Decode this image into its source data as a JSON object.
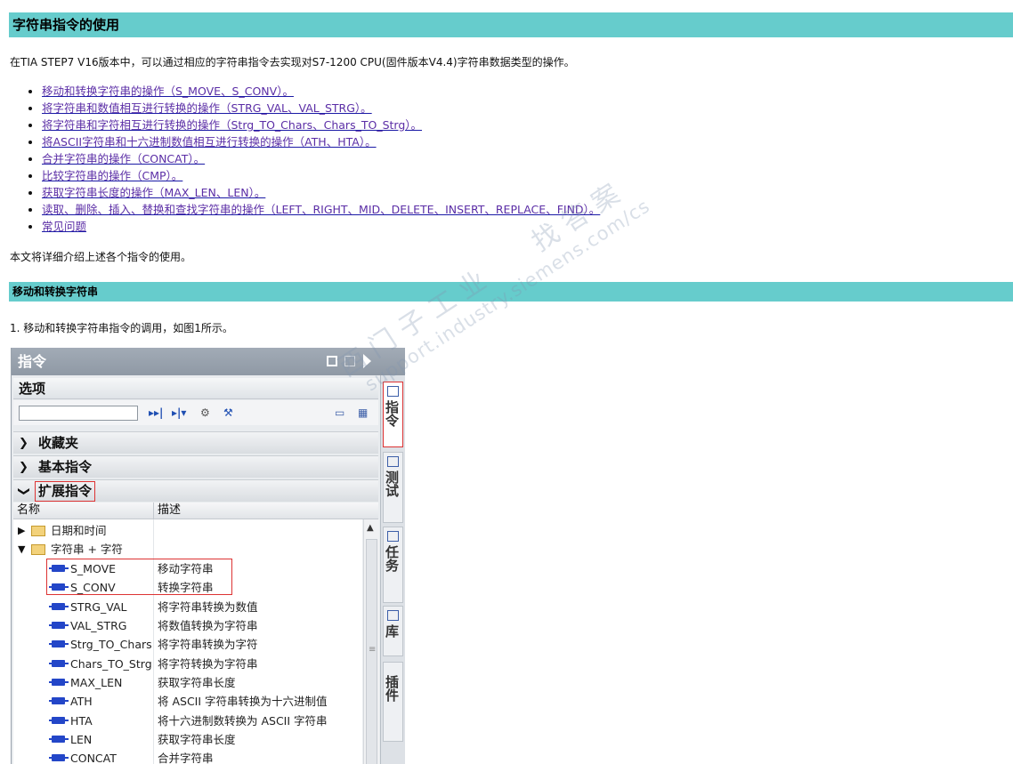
{
  "section1": {
    "title": "字符串指令的使用"
  },
  "intro": "在TIA STEP7 V16版本中，可以通过相应的字符串指令去实现对S7-1200 CPU(固件版本V4.4)字符串数据类型的操作。",
  "toc": [
    "移动和转换字符串的操作（S_MOVE、S_CONV）。",
    "将字符串和数值相互进行转换的操作（STRG_VAL、VAL_STRG）。",
    "将字符串和字符相互进行转换的操作（Strg_TO_Chars、Chars_TO_Strg）。",
    "将ASCII字符串和十六进制数值相互进行转换的操作（ATH、HTA）。",
    "合并字符串的操作（CONCAT）。",
    "比较字符串的操作（CMP）。",
    "获取字符串长度的操作（MAX_LEN、LEN）。",
    "读取、删除、插入、替换和查找字符串的操作（LEFT、RIGHT、MID、DELETE、INSERT、REPLACE、FIND）。",
    "常见问题"
  ],
  "summary": "本文将详细介绍上述各个指令的使用。",
  "section2": {
    "title": "移动和转换字符串"
  },
  "step1": "1. 移动和转换字符串指令的调用，如图1所示。",
  "screenshot": {
    "panel_title": "指令",
    "options_label": "选项",
    "search": {
      "value": ""
    },
    "toolbar_icons": [
      "tree-expand-icon",
      "tree-collapse-icon",
      "overview-icon",
      "settings-icon",
      "view-icon",
      "detail-view-icon"
    ],
    "sections": [
      "收藏夹",
      "基本指令",
      "扩展指令"
    ],
    "columns": {
      "name": "名称",
      "desc": "描述"
    },
    "folders": [
      "日期和时间",
      "字符串 + 字符"
    ],
    "instructions": [
      {
        "name": "S_MOVE",
        "desc": "移动字符串"
      },
      {
        "name": "S_CONV",
        "desc": "转换字符串"
      },
      {
        "name": "STRG_VAL",
        "desc": "将字符串转换为数值"
      },
      {
        "name": "VAL_STRG",
        "desc": "将数值转换为字符串"
      },
      {
        "name": "Strg_TO_Chars",
        "desc": "将字符串转换为字符"
      },
      {
        "name": "Chars_TO_Strg",
        "desc": "将字符转换为字符串"
      },
      {
        "name": "MAX_LEN",
        "desc": "获取字符串长度"
      },
      {
        "name": "ATH",
        "desc": "将 ASCII 字符串转换为十六进制值"
      },
      {
        "name": "HTA",
        "desc": "将十六进制数转换为 ASCII 字符串"
      },
      {
        "name": "LEN",
        "desc": "获取字符串长度"
      },
      {
        "name": "CONCAT",
        "desc": "合并字符串"
      }
    ],
    "side_tabs": [
      "指令",
      "测试",
      "任务",
      "库",
      "插件"
    ],
    "watermark": [
      "西门子工业",
      "找答案",
      "support.industry.siemens.com/cs"
    ]
  }
}
